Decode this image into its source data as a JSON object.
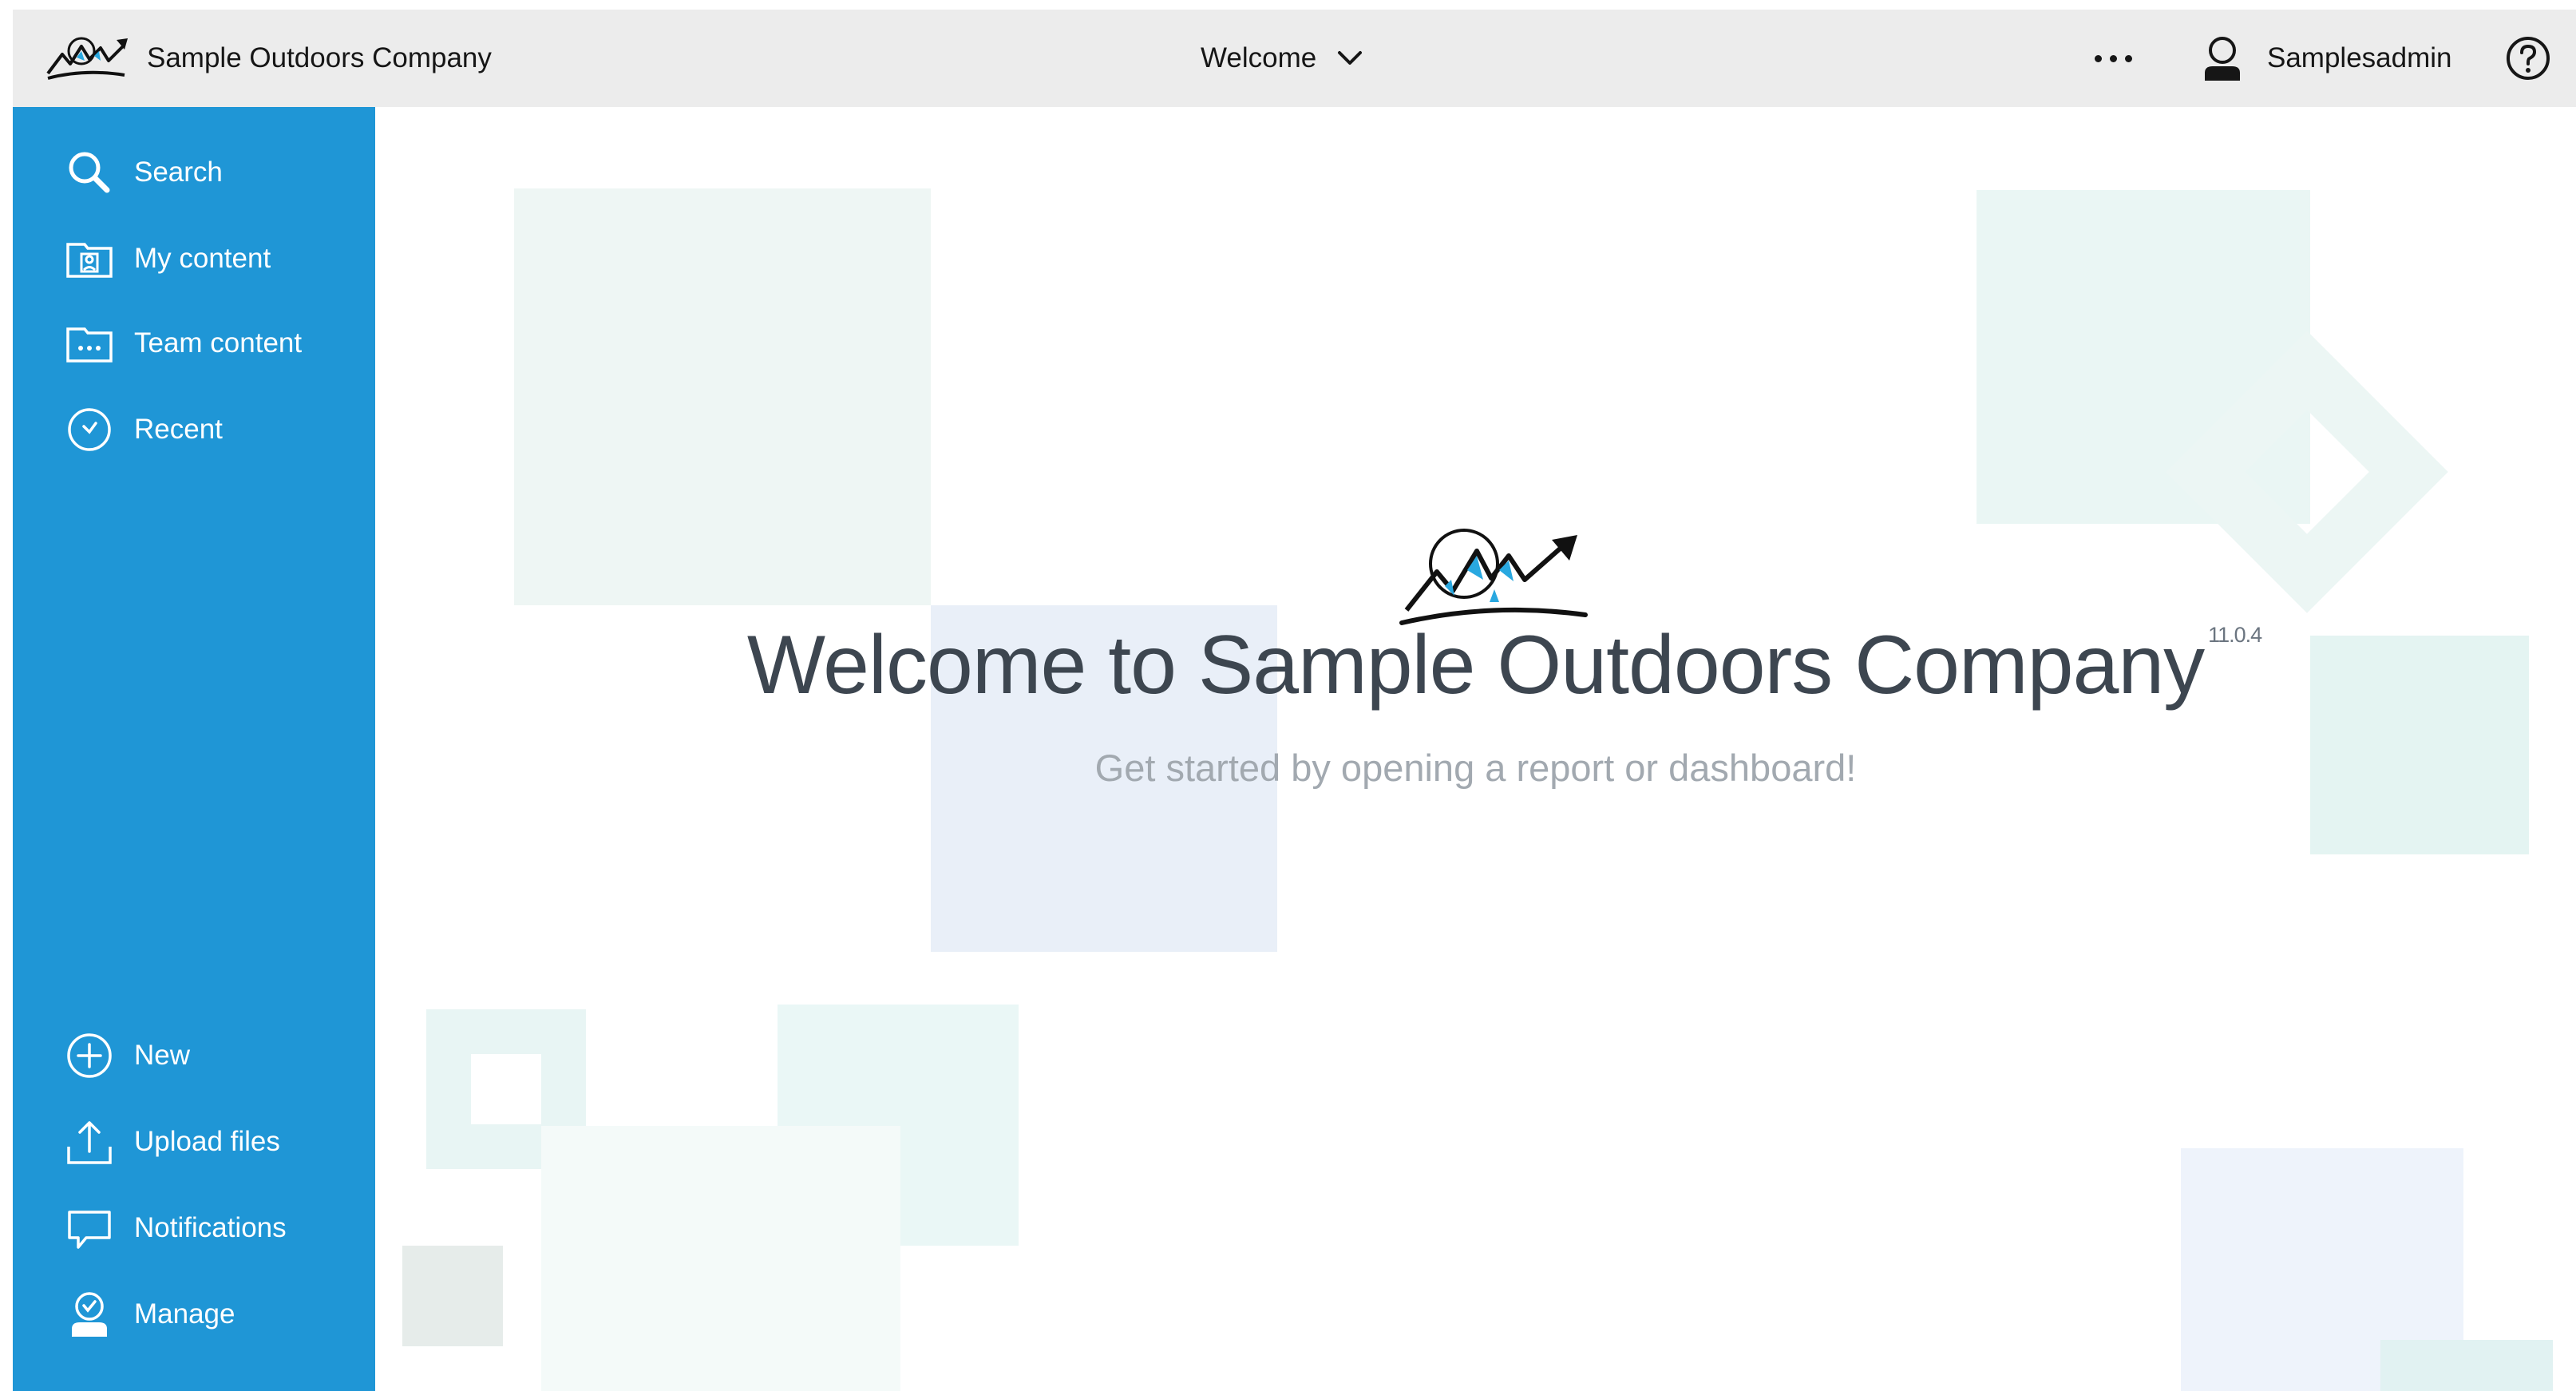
{
  "header": {
    "brand_name": "Sample Outdoors Company",
    "workspace_switcher": {
      "label": "Welcome",
      "icon": "chevron-down-icon"
    },
    "more_menu_icon": "overflow-menu-icon",
    "user": {
      "name": "Samplesadmin",
      "icon": "user-icon"
    },
    "help_icon": "help-icon"
  },
  "sidebar": {
    "top_items": [
      {
        "label": "Search",
        "icon": "search-icon"
      },
      {
        "label": "My content",
        "icon": "my-content-folder-icon"
      },
      {
        "label": "Team content",
        "icon": "team-content-folder-icon"
      },
      {
        "label": "Recent",
        "icon": "clock-icon"
      }
    ],
    "bottom_items": [
      {
        "label": "New",
        "icon": "add-circle-icon"
      },
      {
        "label": "Upload files",
        "icon": "upload-icon"
      },
      {
        "label": "Notifications",
        "icon": "chat-icon"
      },
      {
        "label": "Manage",
        "icon": "manage-user-icon"
      }
    ]
  },
  "welcome": {
    "title": "Welcome to Sample Outdoors Company",
    "version": "11.0.4",
    "subtitle": "Get started by opening a report or dashboard!"
  },
  "colors": {
    "sidebar_bg": "#1f96d6",
    "header_bg": "#ececec",
    "title_text": "#3d4650",
    "subtitle_text": "#a2a9b0",
    "logo_accent": "#29a8e0"
  }
}
